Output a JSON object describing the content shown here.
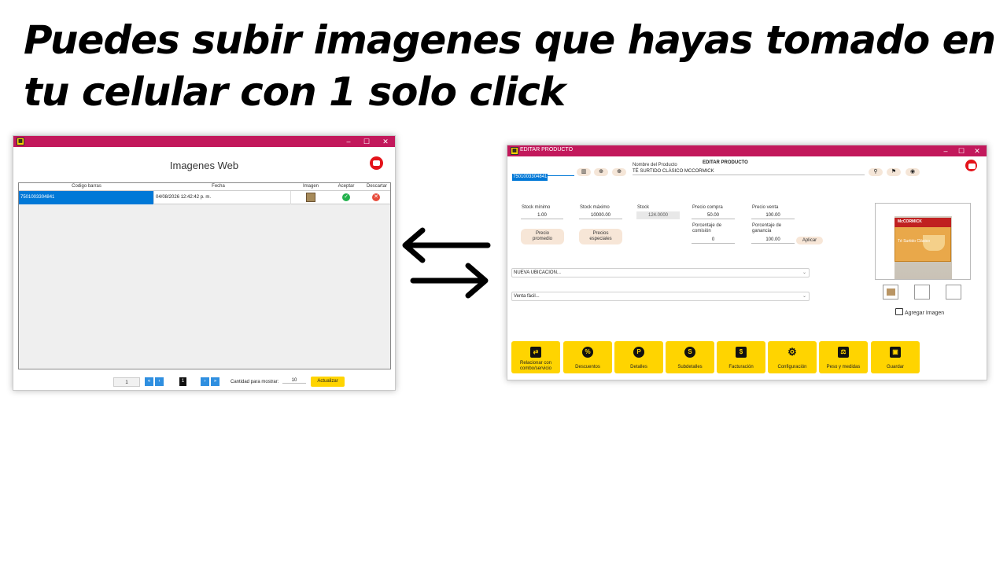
{
  "headline": "Puedes subir imagenes que hayas tomado en tu celular con 1 solo click",
  "left_window": {
    "title": "Imagenes Web",
    "controls": {
      "minimize": "–",
      "maximize": "☐",
      "close": "✕"
    },
    "columns": [
      "Codigo barras",
      "Fecha",
      "Imagen",
      "Aceptar",
      "Descartar"
    ],
    "rows": [
      {
        "barcode": "7501003304841",
        "date": "04/08/2026 12:42:42 p. m."
      }
    ],
    "pager": {
      "page_input": "1",
      "first": "«",
      "prev": "‹",
      "current": "1",
      "next": "›",
      "last": "»",
      "show_label": "Cantidad para mostrar:",
      "show_value": "10",
      "refresh_label": "Actualizar"
    }
  },
  "right_window": {
    "titlebar": "EDITAR PRODUCTO",
    "center_title": "EDITAR PRODUCTO",
    "controls": {
      "minimize": "–",
      "maximize": "☐",
      "close": "✕"
    },
    "barcode": "7501003304841",
    "name_label": "Nombre del Producto",
    "name_value": "TÉ SURTIDO CLÁSICO MCCORMICK",
    "fields": {
      "stock_min_label": "Stock mínimo",
      "stock_min": "1.00",
      "stock_max_label": "Stock máximo",
      "stock_max": "10000.00",
      "stock_label": "Stock",
      "stock": "124.0000",
      "buy_price_label": "Precio compra",
      "buy_price": "50.00",
      "sell_price_label": "Precio venta",
      "sell_price": "100.00",
      "commission_label_1": "Porcentaje de",
      "commission_label_2": "comisión",
      "commission": "0",
      "profit_label_1": "Porcentaje de",
      "profit_label_2": "ganancia",
      "profit": "100.00",
      "apply_label": "Aplicar"
    },
    "avg_price_1": "Precio",
    "avg_price_2": "promedio",
    "special_price_1": "Precios",
    "special_price_2": "especiales",
    "location_value": "NUEVA UBICACION...",
    "sale_value": "Venta fácil...",
    "product_image": {
      "brand": "McCORMICK",
      "label": "Té Surtido Clásico"
    },
    "add_image_label": "Agregar Imagen",
    "tiles": [
      {
        "icon": "⇄",
        "label_1": "Relacionar con",
        "label_2": "combo/servicio"
      },
      {
        "icon": "%",
        "label_1": "Descuentos",
        "label_2": ""
      },
      {
        "icon": "P",
        "label_1": "Detalles",
        "label_2": ""
      },
      {
        "icon": "S",
        "label_1": "Subdetalles",
        "label_2": ""
      },
      {
        "icon": "$",
        "label_1": "Facturación",
        "label_2": ""
      },
      {
        "icon": "⚙",
        "label_1": "Configuración",
        "label_2": ""
      },
      {
        "icon": "⚖",
        "label_1": "Peso y medidas",
        "label_2": ""
      },
      {
        "icon": "▣",
        "label_1": "Guardar",
        "label_2": ""
      }
    ]
  },
  "colors": {
    "titlebar": "#c2185b",
    "accent_yellow": "#ffd400",
    "selection_blue": "#0078d7"
  }
}
